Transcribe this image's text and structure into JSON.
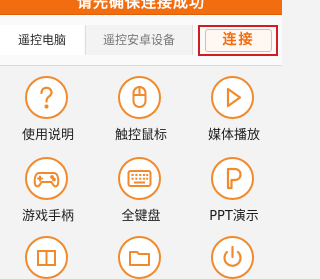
{
  "header": {
    "title": "请先确保连接成功"
  },
  "tabs": {
    "pc": "遥控电脑",
    "android": "遥控安卓设备",
    "connect": "连接"
  },
  "grid": [
    {
      "label": "使用说明",
      "icon": "help-icon"
    },
    {
      "label": "触控鼠标",
      "icon": "mouse-icon"
    },
    {
      "label": "媒体播放",
      "icon": "play-icon"
    },
    {
      "label": "游戏手柄",
      "icon": "gamepad-icon"
    },
    {
      "label": "全键盘",
      "icon": "keyboard-icon"
    },
    {
      "label": "PPT演示",
      "icon": "ppt-icon"
    },
    {
      "label": "",
      "icon": "gift-icon"
    },
    {
      "label": "",
      "icon": "folder-icon"
    },
    {
      "label": "",
      "icon": "power-icon"
    }
  ],
  "colors": {
    "accent": "#f26d10",
    "icon_stroke": "#f08a2c",
    "highlight_box": "#d01d22"
  }
}
